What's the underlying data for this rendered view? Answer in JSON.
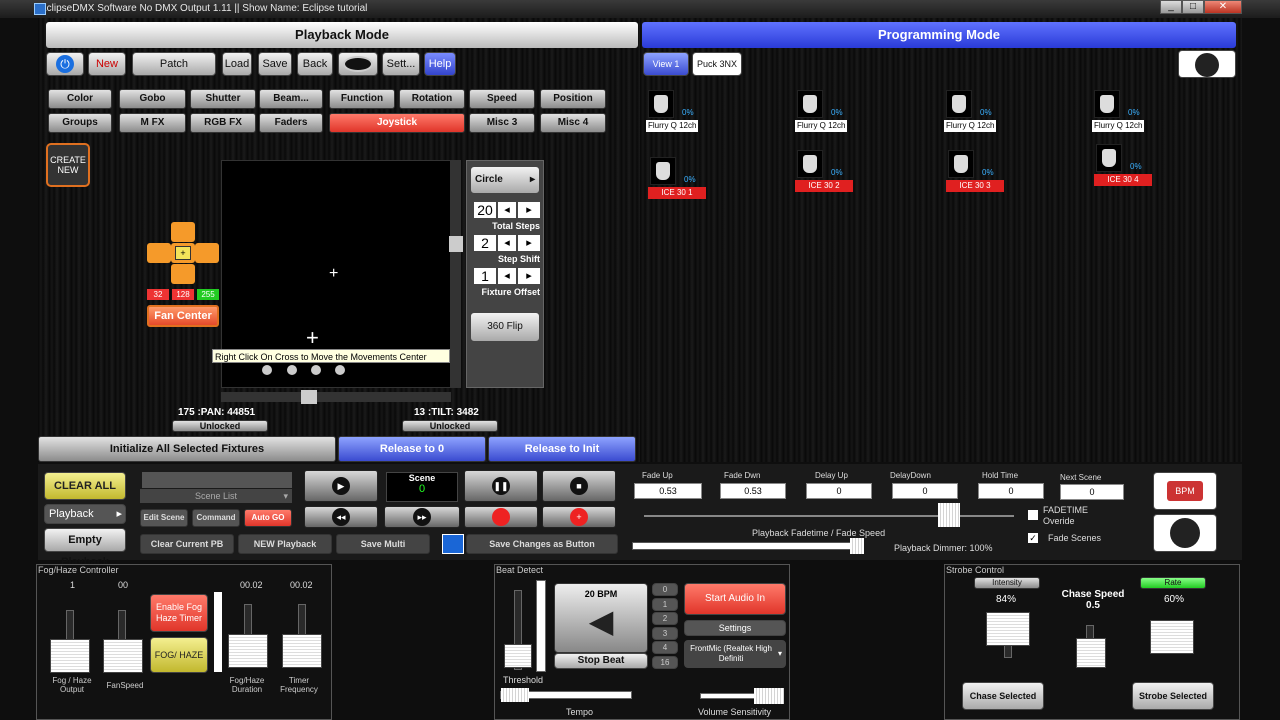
{
  "window": {
    "title": "EclipseDMX Software No DMX Output 1.11 || Show Name: Eclipse tutorial",
    "min": "_",
    "max": "□",
    "close": "✕"
  },
  "modes": {
    "playback": "Playback Mode",
    "programming": "Programming Mode"
  },
  "toolbar": {
    "new": "New",
    "patch": "Patch",
    "load": "Load",
    "save": "Save",
    "back": "Back",
    "settings": "Sett...",
    "help": "Help"
  },
  "views": {
    "view1": "View 1",
    "puck": "Puck 3NX"
  },
  "categories": [
    "Color",
    "Gobo",
    "Shutter",
    "Beam...",
    "Function",
    "Rotation",
    "Speed",
    "Position",
    "Groups",
    "M FX",
    "RGB FX",
    "Faders",
    "Joystick",
    "Misc 3",
    "Misc 4"
  ],
  "create_new": "CREATE NEW",
  "fan": {
    "v1": "32",
    "v2": "128",
    "v3": "255",
    "label": "Fan Center"
  },
  "movement": {
    "tooltip": "Right Click On Cross to Move the Movements Center",
    "pan": "175 :PAN: 44851",
    "tilt": "13 :TILT: 3482",
    "unlocked": "Unlocked"
  },
  "shape": {
    "name": "Circle",
    "steps": "20",
    "steps_label": "Total Steps",
    "shift": "2",
    "shift_label": "Step Shift",
    "offset": "1",
    "offset_label": "Fixture Offset",
    "flip": "360 Flip"
  },
  "actions": {
    "init": "Initialize All Selected Fixtures",
    "release0": "Release to 0",
    "releaseInit": "Release to Init"
  },
  "fixtures": [
    {
      "name": "Flurry Q 12ch",
      "pct": "0%"
    },
    {
      "name": "Flurry Q 12ch",
      "pct": "0%"
    },
    {
      "name": "Flurry Q 12ch",
      "pct": "0%"
    },
    {
      "name": "Flurry Q 12ch",
      "pct": "0%"
    },
    {
      "name": "ICE 30 1",
      "pct": "0%"
    },
    {
      "name": "ICE 30 2",
      "pct": "0%"
    },
    {
      "name": "ICE 30 3",
      "pct": "0%"
    },
    {
      "name": "ICE 30 4",
      "pct": "0%"
    }
  ],
  "playback": {
    "clear_all": "CLEAR ALL",
    "playback": "Playback",
    "empty": "Empty Playback",
    "scene_list": "Scene List",
    "edit_scene": "Edit Scene",
    "command": "Command",
    "auto_go": "Auto GO",
    "scene": "Scene",
    "scene_num": "0",
    "clear_pb": "Clear Current PB",
    "new_pb": "NEW Playback",
    "save_multi": "Save Multi",
    "save_changes": "Save Changes as Button"
  },
  "times": {
    "fade_up": "Fade Up",
    "fade_up_v": "0.53",
    "fade_dwn": "Fade Dwn",
    "fade_dwn_v": "0.53",
    "delay_up": "Delay Up",
    "delay_up_v": "0",
    "delay_down": "DelayDown",
    "delay_down_v": "0",
    "hold": "Hold Time",
    "hold_v": "0",
    "next": "Next Scene",
    "next_v": "0",
    "fadetime_override": "FADETIME Overide",
    "fade_scenes": "Fade Scenes",
    "fade_speed": "Playback Fadetime / Fade Speed",
    "dimmer": "Playback Dimmer: 100%",
    "bpm": "BPM"
  },
  "fog": {
    "title": "Fog/Haze Controller",
    "v_out": "1",
    "v_fan": "00",
    "v_dur": "00.02",
    "v_freq": "00.02",
    "enable": "Enable Fog Haze Timer",
    "fog": "FOG/ HAZE",
    "l_out": "Fog / Haze Output",
    "l_fan": "FanSpeed",
    "l_dur": "Fog/Haze Duration",
    "l_freq": "Timer Frequency"
  },
  "beat": {
    "title": "Beat Detect",
    "bpm": "20 BPM",
    "stop": "Stop Beat",
    "start": "Start Audio In",
    "settings": "Settings",
    "device": "FrontMic (Realtek High Definiti",
    "nums": [
      "0",
      "1",
      "2",
      "3",
      "4",
      "16"
    ],
    "threshold": "Threshold",
    "tempo": "Tempo",
    "volume": "Volume Sensitivity"
  },
  "strobe": {
    "title": "Strobe Control",
    "intensity": "Intensity",
    "intensity_v": "84%",
    "chase": "Chase Speed",
    "chase_v": "0.5",
    "rate": "Rate",
    "rate_v": "60%",
    "chase_sel": "Chase Selected",
    "strobe_sel": "Strobe Selected"
  }
}
